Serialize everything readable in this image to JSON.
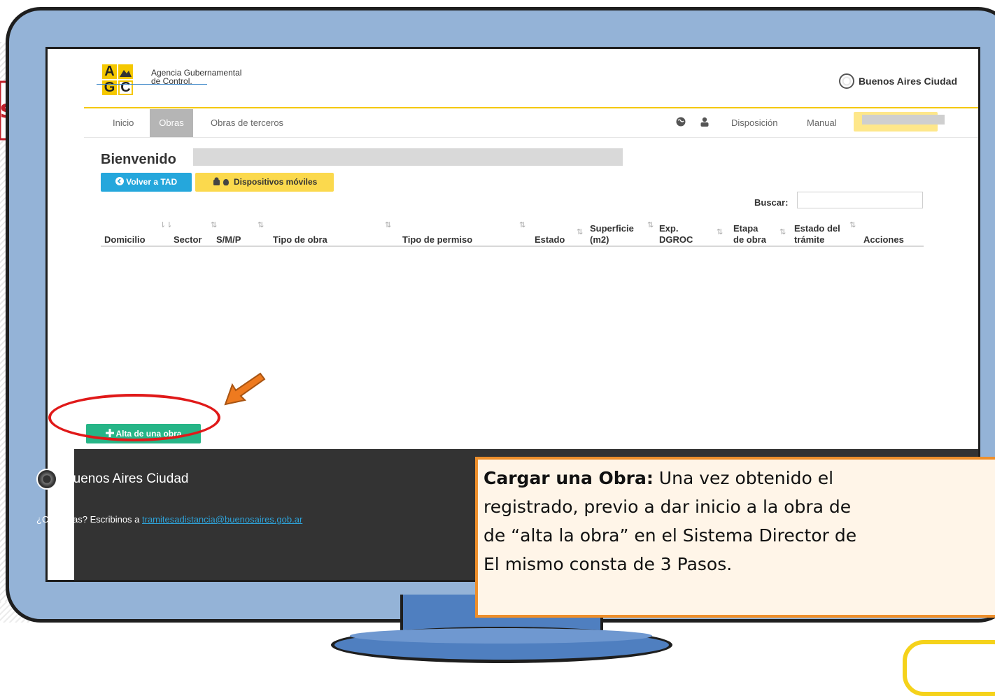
{
  "slide": {
    "left_tag": "so",
    "callout": {
      "lead": "Cargar una Obra:",
      "line1": " Una vez obtenido el",
      "line2": "registrado, previo a dar inicio a la obra de",
      "line3": "de “alta la obra” en el Sistema Director de",
      "line4": "El mismo consta de 3 Pasos."
    }
  },
  "app": {
    "logo": {
      "letters": [
        "A",
        "",
        "G",
        "C"
      ],
      "name_line1": "Agencia Gubernamental",
      "name_line2": "de Control."
    },
    "brand_right": "Buenos Aires Ciudad",
    "nav": {
      "items": [
        "Inicio",
        "Obras",
        "Obras de terceros"
      ],
      "active": "Obras",
      "right_items": [
        "Disposición",
        "Manual"
      ],
      "icons": [
        "globe-icon",
        "user-icon"
      ]
    },
    "welcome": "Bienvenido",
    "buttons": {
      "volver": "Volver a TAD",
      "dispositivos": "Dispositivos móviles",
      "alta": "Alta de una obra"
    },
    "search_label": "Buscar:",
    "table_headers": [
      [
        "Domicilio"
      ],
      [
        "Sector"
      ],
      [
        "S/M/P"
      ],
      [
        "Tipo de obra"
      ],
      [
        "Tipo de permiso"
      ],
      [
        "Estado"
      ],
      [
        "Superficie",
        "(m2)"
      ],
      [
        "Exp.",
        "DGROC"
      ],
      [
        "Etapa",
        "de obra"
      ],
      [
        "Estado del",
        "trámite"
      ],
      [
        "Acciones"
      ]
    ],
    "footer": {
      "brand": "Buenos Aires Ciudad",
      "text": "¿Consultas? Escribinos a ",
      "email": "tramitesadistancia@buenosaires.gob.ar"
    },
    "colors": {
      "accent_yellow": "#f5c800",
      "button_blue": "#25a7dc",
      "button_green": "#26b587",
      "footer_bg": "#333333",
      "monitor": "#94b3d7",
      "callout_border": "#ee8f2b",
      "highlight_red": "#e01919"
    }
  }
}
